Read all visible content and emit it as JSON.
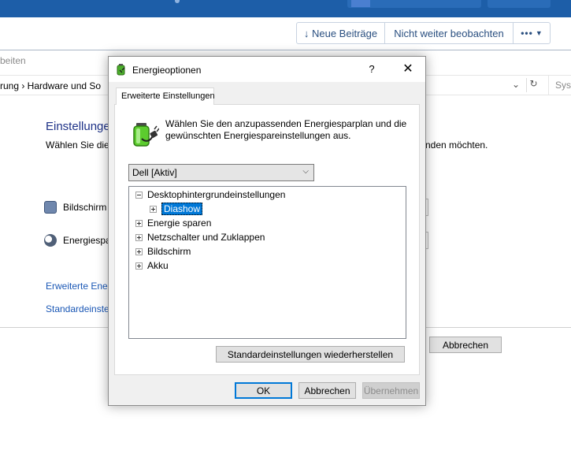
{
  "forum": {
    "new_posts_label": "↓ Neue Beiträge",
    "unfollow_label": "Nicht weiter beobachten",
    "more_label": "•••"
  },
  "control_panel": {
    "window_title_fragment": "beiten",
    "breadcrumb": "rung  ›  Hardware und So",
    "search_fragment": "Syst",
    "heading_fragment": "Einstellunge",
    "description_left": "Wählen Sie die",
    "description_right": "nden möchten.",
    "row1_label": "Bildschirm",
    "row2_label": "Energiespa",
    "link1": "Erweiterte Ener",
    "link2": "Standardeinste",
    "cancel_label": "Abbrechen"
  },
  "dialog": {
    "title": "Energieoptionen",
    "help_label": "?",
    "close_label": "✕",
    "tab_label": "Erweiterte Einstellungen",
    "intro_text": "Wählen Sie den anzupassenden Energiesparplan und die gewünschten Energiespareinstellungen aus.",
    "plan_selected": "Dell [Aktiv]",
    "tree": [
      {
        "label": "Desktophintergrundeinstellungen",
        "expanded": true,
        "level": 0
      },
      {
        "label": "Diashow",
        "expanded": false,
        "level": 1,
        "selected": true
      },
      {
        "label": "Energie sparen",
        "expanded": false,
        "level": 0
      },
      {
        "label": "Netzschalter und Zuklappen",
        "expanded": false,
        "level": 0
      },
      {
        "label": "Bildschirm",
        "expanded": false,
        "level": 0
      },
      {
        "label": "Akku",
        "expanded": false,
        "level": 0
      }
    ],
    "restore_label": "Standardeinstellungen wiederherstellen",
    "ok_label": "OK",
    "cancel_label": "Abbrechen",
    "apply_label": "Übernehmen"
  },
  "colors": {
    "forum_header": "#1d5ea8",
    "selection": "#0078d7",
    "link": "#1a57b5",
    "heading": "#1e3287"
  },
  "icons": [
    "battery-plug-icon",
    "chevron-down-icon",
    "refresh-icon",
    "expand-icon",
    "collapse-icon",
    "monitor-clock-icon",
    "moon-icon"
  ]
}
